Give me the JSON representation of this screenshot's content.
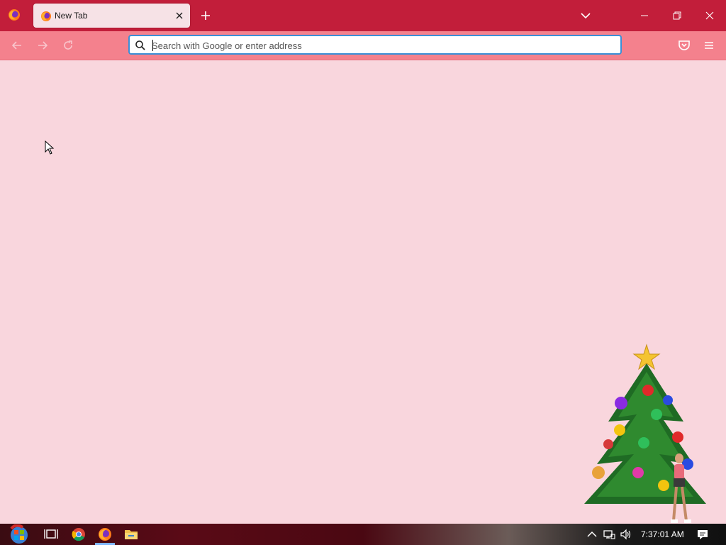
{
  "browser": {
    "tab": {
      "title": "New Tab"
    },
    "urlbar": {
      "placeholder": "Search with Google or enter address"
    }
  },
  "taskbar": {
    "clock": "7:37:01 AM"
  },
  "icons": {
    "titlebar": [
      "firefox-icon",
      "close-tab-icon",
      "plus-icon",
      "chevron-down-icon",
      "minimize-icon",
      "restore-icon",
      "close-icon"
    ],
    "navbar": [
      "back-arrow-icon",
      "forward-arrow-icon",
      "reload-icon",
      "search-icon",
      "pocket-icon",
      "hamburger-menu-icon"
    ],
    "taskbar": [
      "start-orb-icon",
      "task-view-icon",
      "chrome-icon",
      "firefox-icon",
      "file-explorer-icon",
      "chevron-up-icon",
      "network-icon",
      "speaker-icon",
      "notification-icon"
    ]
  },
  "colors": {
    "titlebar": "#c21e3a",
    "toolbar": "#f4818d",
    "content": "#f9d6dd",
    "focus": "#3a8fd6"
  }
}
